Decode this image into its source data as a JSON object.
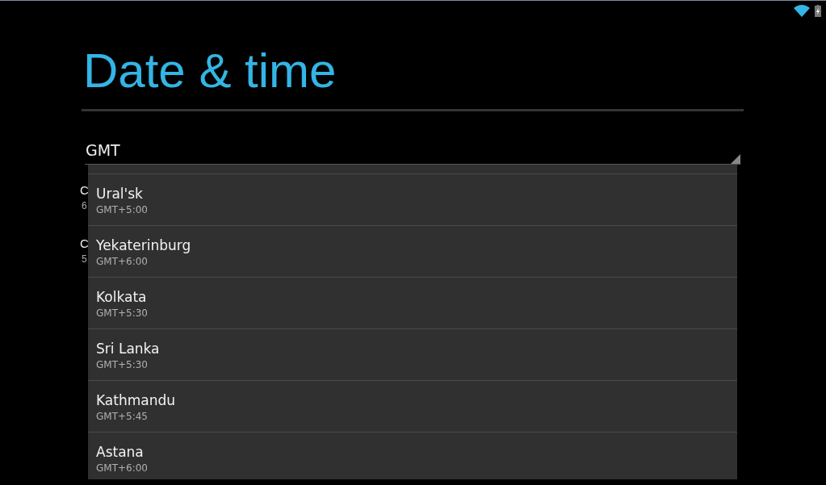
{
  "title": "Date & time",
  "spinner": {
    "value": "GMT"
  },
  "background_rows": [
    {
      "title": "C",
      "summary": "6"
    },
    {
      "title": "C",
      "summary": "5"
    }
  ],
  "timezones": [
    {
      "name": "Ural'sk",
      "offset": "GMT+5:00"
    },
    {
      "name": "Yekaterinburg",
      "offset": "GMT+6:00"
    },
    {
      "name": "Kolkata",
      "offset": "GMT+5:30"
    },
    {
      "name": "Sri Lanka",
      "offset": "GMT+5:30"
    },
    {
      "name": "Kathmandu",
      "offset": "GMT+5:45"
    },
    {
      "name": "Astana",
      "offset": "GMT+6:00"
    }
  ]
}
